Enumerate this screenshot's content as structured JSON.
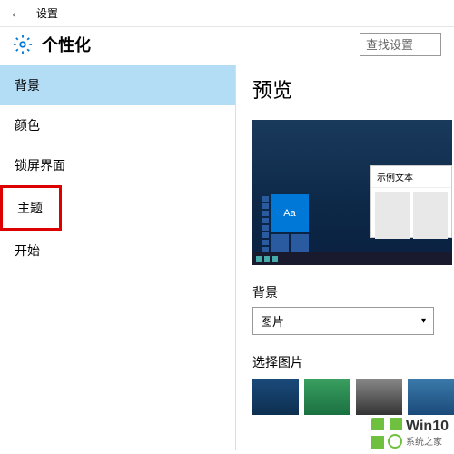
{
  "titlebar": {
    "back": "←",
    "text": "设置"
  },
  "header": {
    "title": "个性化",
    "search_placeholder": "查找设置"
  },
  "sidebar": {
    "items": [
      {
        "label": "背景"
      },
      {
        "label": "颜色"
      },
      {
        "label": "锁屏界面"
      },
      {
        "label": "主题"
      },
      {
        "label": "开始"
      }
    ]
  },
  "main": {
    "preview_title": "预览",
    "window_sample": "示例文本",
    "tile_text": "Aa",
    "bg_label": "背景",
    "bg_value": "图片",
    "choose_label": "选择图片"
  },
  "watermark": {
    "brand": "Win10",
    "site": "系统之家"
  }
}
